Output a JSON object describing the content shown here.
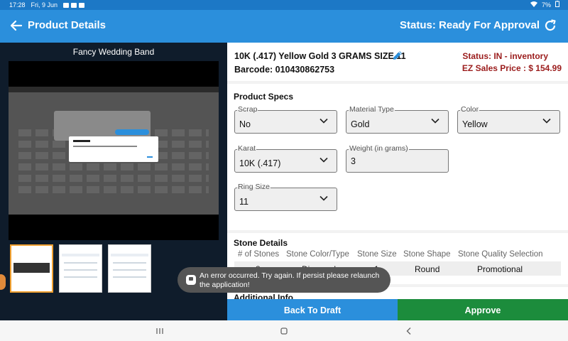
{
  "statusbar": {
    "time": "17:28",
    "date": "Fri, 9 Jun",
    "battery": "7%"
  },
  "appbar": {
    "title": "Product Details",
    "status": "Status: Ready For Approval",
    "back_icon": "arrow-left-icon",
    "refresh_icon": "refresh-icon"
  },
  "gallery": {
    "title": "Fancy Wedding Band",
    "thumbnail_count": 3,
    "selected_thumbnail": 1
  },
  "product": {
    "name": "10K (.417) Yellow Gold 3 GRAMS SIZE 11",
    "barcode": "Barcode: 010430862753",
    "inventory_status": "Status: IN - inventory",
    "price": "EZ Sales Price : $ 154.99",
    "price_color": "#9b1c1c"
  },
  "specs": {
    "title": "Product Specs",
    "scrap": {
      "label": "Scrap",
      "value": "No"
    },
    "material_type": {
      "label": "Material Type",
      "value": "Gold"
    },
    "color": {
      "label": "Color",
      "value": "Yellow"
    },
    "karat": {
      "label": "Karat",
      "value": "10K (.417)"
    },
    "weight": {
      "label": "Weight (in grams)",
      "value": "3"
    },
    "ring_size": {
      "label": "Ring Size",
      "value": "11"
    }
  },
  "stones": {
    "title": "Stone Details",
    "columns": [
      "# of Stones",
      "Stone Color/Type",
      "Stone Size",
      "Stone Shape",
      "Stone Quality Selection"
    ],
    "rows": [
      [
        "8",
        "Diamond",
        "1",
        "Round",
        "Promotional"
      ]
    ]
  },
  "additional": {
    "title": "Additional Info"
  },
  "actions": {
    "back_to_draft": "Back To Draft",
    "approve": "Approve",
    "draft_color": "#2b8fdc",
    "approve_color": "#1c8c3c"
  },
  "toast": {
    "message": "An error occurred. Try again. If persist please relaunch the application!"
  }
}
